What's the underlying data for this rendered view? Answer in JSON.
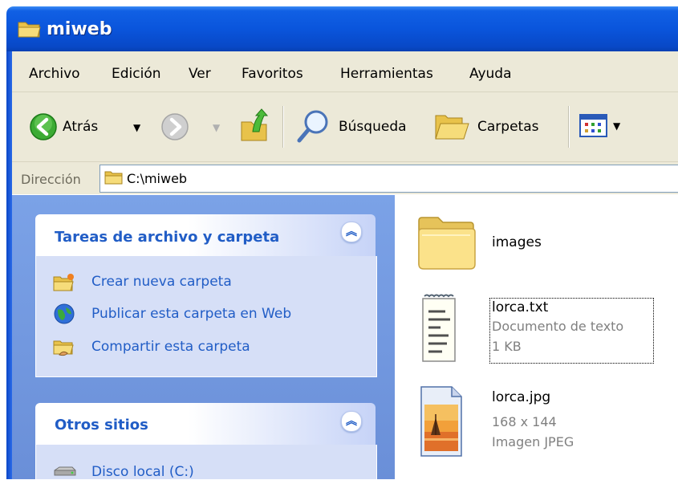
{
  "window": {
    "title": "miweb"
  },
  "menu": [
    "Archivo",
    "Edición",
    "Ver",
    "Favoritos",
    "Herramientas",
    "Ayuda"
  ],
  "toolbar": {
    "back_label": "Atrás",
    "search_label": "Búsqueda",
    "folders_label": "Carpetas"
  },
  "address": {
    "label": "Dirección",
    "value": "C:\\miweb"
  },
  "tasks_panel": {
    "title": "Tareas de archivo y carpeta",
    "items": [
      "Crear nueva carpeta",
      "Publicar esta carpeta en Web",
      "Compartir esta carpeta"
    ]
  },
  "other_places": {
    "title": "Otros sitios",
    "items": [
      "Disco local (C:)"
    ]
  },
  "files": [
    {
      "name": "images",
      "type_icon": "folder-icon"
    },
    {
      "name": "lorca.txt",
      "detail1": "Documento de texto",
      "detail2": "1 KB",
      "type_icon": "text-file-icon"
    },
    {
      "name": "lorca.jpg",
      "detail1": "168 x 144",
      "detail2": "Imagen JPEG",
      "type_icon": "image-file-icon"
    }
  ],
  "colors": {
    "titlebar": "#0a55dc",
    "link": "#215dc6",
    "chrome": "#ece9d8",
    "pane": "#6a8fd8"
  }
}
